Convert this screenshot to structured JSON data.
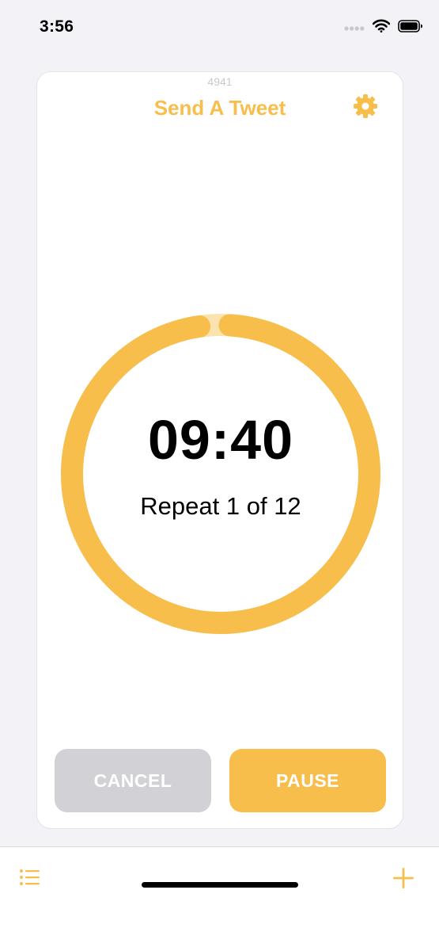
{
  "status_bar": {
    "time": "3:56",
    "icons": [
      "signal-dots-icon",
      "wifi-icon",
      "battery-icon"
    ]
  },
  "timer": {
    "id": "4941",
    "name": "Send A Tweet",
    "time_remaining": "09:40",
    "repeat_text": "Repeat 1 of 12",
    "progress": 0.967
  },
  "buttons": {
    "cancel_label": "CANCEL",
    "pause_label": "PAUSE"
  },
  "tab_bar": {
    "left_icon": "list-icon",
    "right_icon": "plus-icon"
  },
  "colors": {
    "accent": "#F8BE4C",
    "accent_light": "#FBE3B0",
    "cancel_bg": "#D1D1D6",
    "background": "#F2F2F7",
    "card": "#FFFFFF"
  }
}
